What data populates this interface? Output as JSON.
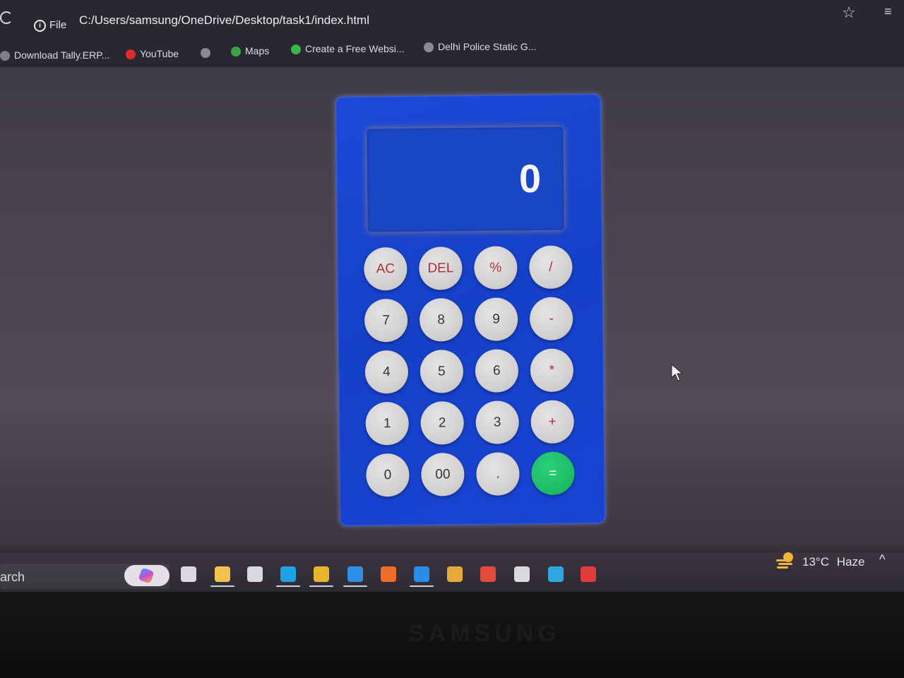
{
  "browser": {
    "file_label": "File",
    "url": "C:/Users/samsung/OneDrive/Desktop/task1/index.html"
  },
  "bookmarks": [
    {
      "label": "Download Tally.ERP...",
      "icon": "globe-icon",
      "color": "#7e7e86"
    },
    {
      "label": "YouTube",
      "icon": "youtube-icon",
      "color": "#e02b2b"
    },
    {
      "label": "",
      "icon": "globe-icon",
      "color": "#8a8a92"
    },
    {
      "label": "Maps",
      "icon": "maps-icon",
      "color": "#3aa34a"
    },
    {
      "label": "Create a Free Websi...",
      "icon": "wix-icon",
      "color": "#39b54a"
    },
    {
      "label": "Delhi Police Static G...",
      "icon": "globe-icon",
      "color": "#8a8a92"
    }
  ],
  "calculator": {
    "display_value": "0",
    "keys": [
      {
        "label": "AC",
        "type": "fn"
      },
      {
        "label": "DEL",
        "type": "fn"
      },
      {
        "label": "%",
        "type": "fn"
      },
      {
        "label": "/",
        "type": "fn"
      },
      {
        "label": "7",
        "type": "num"
      },
      {
        "label": "8",
        "type": "num"
      },
      {
        "label": "9",
        "type": "num"
      },
      {
        "label": "-",
        "type": "fn"
      },
      {
        "label": "4",
        "type": "num"
      },
      {
        "label": "5",
        "type": "num"
      },
      {
        "label": "6",
        "type": "num"
      },
      {
        "label": "*",
        "type": "fn"
      },
      {
        "label": "1",
        "type": "num"
      },
      {
        "label": "2",
        "type": "num"
      },
      {
        "label": "3",
        "type": "num"
      },
      {
        "label": "+",
        "type": "fn"
      },
      {
        "label": "0",
        "type": "num"
      },
      {
        "label": "00",
        "type": "num"
      },
      {
        "label": ".",
        "type": "num"
      },
      {
        "label": "=",
        "type": "eq"
      }
    ]
  },
  "taskbar": {
    "search_text": "arch",
    "icons": [
      {
        "name": "task-view-icon",
        "color": "#d8d8de"
      },
      {
        "name": "file-explorer-icon",
        "color": "#f2c14e"
      },
      {
        "name": "store-icon",
        "color": "#d8d8de"
      },
      {
        "name": "edge-icon",
        "color": "#1ea3e6"
      },
      {
        "name": "chrome-icon",
        "color": "#e9b52d"
      },
      {
        "name": "mail-icon",
        "color": "#2f8fe6"
      },
      {
        "name": "firefox-icon",
        "color": "#f06a2a"
      },
      {
        "name": "vscode-icon",
        "color": "#2a8ee6"
      },
      {
        "name": "3d-box-icon",
        "color": "#e6a93a"
      },
      {
        "name": "tiles-app-icon",
        "color": "#e24a3a"
      },
      {
        "name": "document-app-icon",
        "color": "#d8d8de"
      },
      {
        "name": "telegram-icon",
        "color": "#2ea6df"
      },
      {
        "name": "adobe-icon",
        "color": "#e23b3b"
      }
    ],
    "weather": {
      "temp": "13°C",
      "condition": "Haze"
    }
  }
}
